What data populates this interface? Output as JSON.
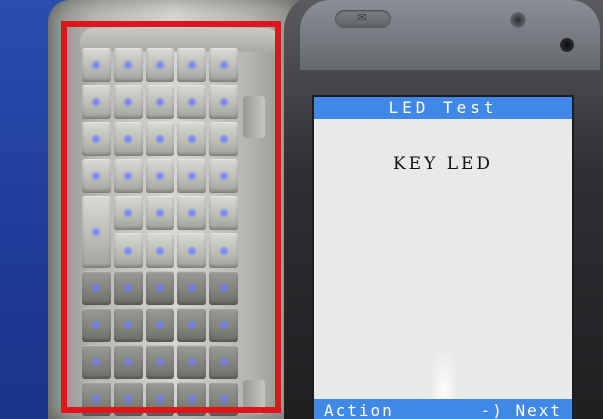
{
  "screen": {
    "title": "LED   Test",
    "heading": "KEY LED",
    "softkeys": {
      "left": "Action",
      "right": "-) Next"
    }
  },
  "colors": {
    "highlight_border": "#e0151c",
    "title_bar": "#3f88e6",
    "screen_bg": "#e7e9ea",
    "background": "#1f3f9a",
    "key_led": "#6d7dff"
  },
  "icons": {
    "speaker": "speaker-icon",
    "camera": "camera-icon"
  }
}
